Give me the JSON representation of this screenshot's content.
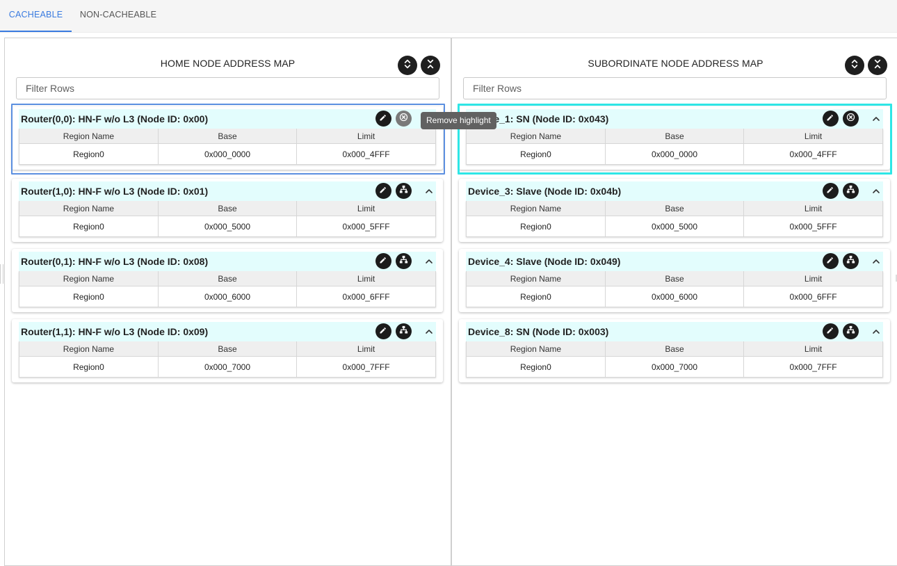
{
  "tabs": [
    {
      "label": "CACHEABLE",
      "active": true
    },
    {
      "label": "NON-CACHEABLE",
      "active": false
    }
  ],
  "colors": {
    "accent": "#3a7be0",
    "card_header_bg": "#e3fdfd",
    "highlight_blue": "#5b8fe0",
    "highlight_cyan": "#2ee6e6"
  },
  "home_panel": {
    "title": "HOME NODE ADDRESS MAP",
    "filter_placeholder": "Filter Rows",
    "expand_all_icon": "unfold-more-icon",
    "collapse_all_icon": "unfold-less-icon",
    "columns": [
      "Region Name",
      "Base",
      "Limit"
    ],
    "cards": [
      {
        "title": "Router(0,0): HN-F w/o L3 (Node ID: 0x00)",
        "highlighted": true,
        "action_icon": "close-circle-icon",
        "row": {
          "region": "Region0",
          "base": "0x000_0000",
          "limit": "0x000_4FFF"
        }
      },
      {
        "title": "Router(1,0): HN-F w/o L3 (Node ID: 0x01)",
        "highlighted": false,
        "action_icon": "hierarchy-icon",
        "row": {
          "region": "Region0",
          "base": "0x000_5000",
          "limit": "0x000_5FFF"
        }
      },
      {
        "title": "Router(0,1): HN-F w/o L3 (Node ID: 0x08)",
        "highlighted": false,
        "action_icon": "hierarchy-icon",
        "row": {
          "region": "Region0",
          "base": "0x000_6000",
          "limit": "0x000_6FFF"
        }
      },
      {
        "title": "Router(1,1): HN-F w/o L3 (Node ID: 0x09)",
        "highlighted": false,
        "action_icon": "hierarchy-icon",
        "row": {
          "region": "Region0",
          "base": "0x000_7000",
          "limit": "0x000_7FFF"
        }
      }
    ]
  },
  "sub_panel": {
    "title": "SUBORDINATE NODE ADDRESS MAP",
    "filter_placeholder": "Filter Rows",
    "expand_all_icon": "unfold-more-icon",
    "collapse_all_icon": "unfold-less-icon",
    "columns": [
      "Region Name",
      "Base",
      "Limit"
    ],
    "cards": [
      {
        "title": "Device_1: SN (Node ID: 0x043)",
        "highlighted": true,
        "action_icon": "close-circle-icon",
        "row": {
          "region": "Region0",
          "base": "0x000_0000",
          "limit": "0x000_4FFF"
        }
      },
      {
        "title": "Device_3: Slave (Node ID: 0x04b)",
        "highlighted": false,
        "action_icon": "hierarchy-icon",
        "row": {
          "region": "Region0",
          "base": "0x000_5000",
          "limit": "0x000_5FFF"
        }
      },
      {
        "title": "Device_4: Slave (Node ID: 0x049)",
        "highlighted": false,
        "action_icon": "hierarchy-icon",
        "row": {
          "region": "Region0",
          "base": "0x000_6000",
          "limit": "0x000_6FFF"
        }
      },
      {
        "title": "Device_8: SN (Node ID: 0x003)",
        "highlighted": false,
        "action_icon": "hierarchy-icon",
        "row": {
          "region": "Region0",
          "base": "0x000_7000",
          "limit": "0x000_7FFF"
        }
      }
    ]
  },
  "tooltip": {
    "text": "Remove highlight"
  }
}
